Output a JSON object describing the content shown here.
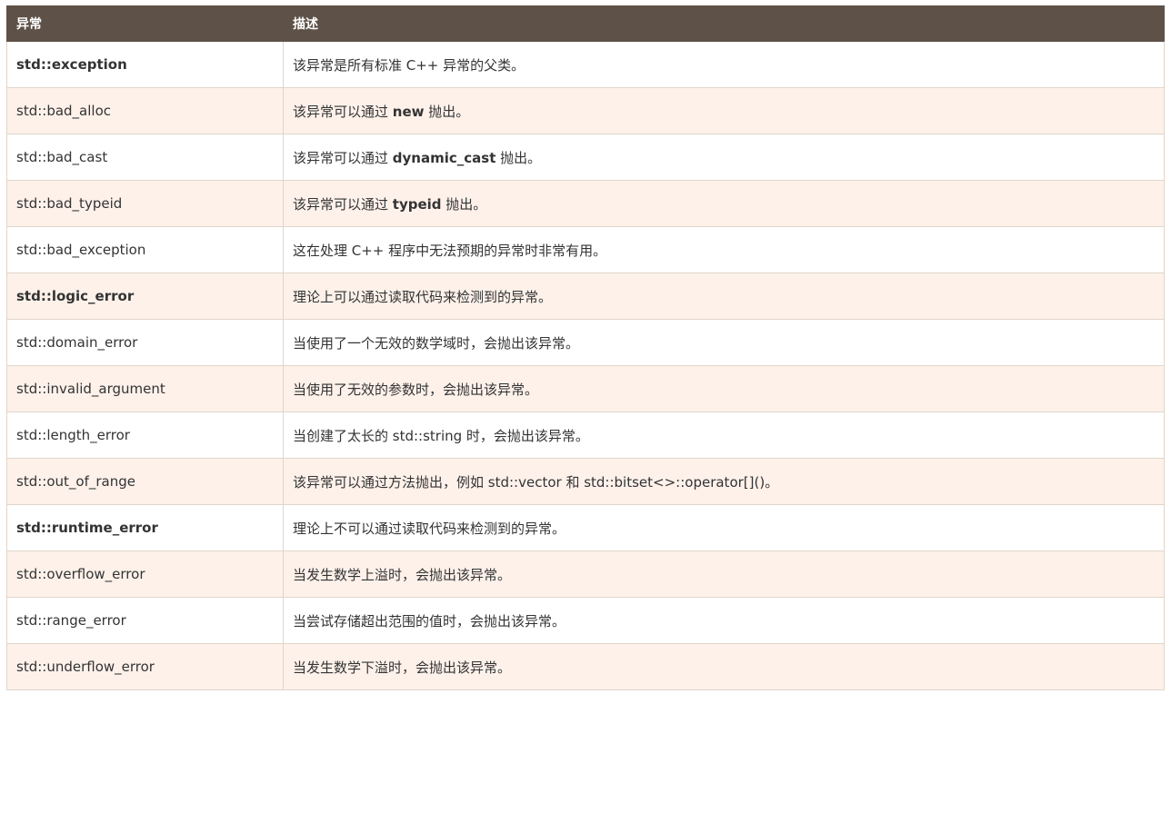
{
  "headers": [
    "异常",
    "描述"
  ],
  "rows": [
    {
      "name": "std::exception",
      "bold": true,
      "desc": [
        {
          "t": "该异常是所有标准 C++ 异常的父类。"
        }
      ]
    },
    {
      "name": "std::bad_alloc",
      "bold": false,
      "desc": [
        {
          "t": "该异常可以通过 "
        },
        {
          "t": "new",
          "b": true
        },
        {
          "t": " 抛出。"
        }
      ]
    },
    {
      "name": "std::bad_cast",
      "bold": false,
      "desc": [
        {
          "t": "该异常可以通过 "
        },
        {
          "t": "dynamic_cast",
          "b": true
        },
        {
          "t": " 抛出。"
        }
      ]
    },
    {
      "name": "std::bad_typeid",
      "bold": false,
      "desc": [
        {
          "t": "该异常可以通过 "
        },
        {
          "t": "typeid",
          "b": true
        },
        {
          "t": " 抛出。"
        }
      ]
    },
    {
      "name": "std::bad_exception",
      "bold": false,
      "desc": [
        {
          "t": "这在处理 C++ 程序中无法预期的异常时非常有用。"
        }
      ]
    },
    {
      "name": "std::logic_error",
      "bold": true,
      "desc": [
        {
          "t": "理论上可以通过读取代码来检测到的异常。"
        }
      ]
    },
    {
      "name": "std::domain_error",
      "bold": false,
      "desc": [
        {
          "t": "当使用了一个无效的数学域时，会抛出该异常。"
        }
      ]
    },
    {
      "name": "std::invalid_argument",
      "bold": false,
      "desc": [
        {
          "t": "当使用了无效的参数时，会抛出该异常。"
        }
      ]
    },
    {
      "name": "std::length_error",
      "bold": false,
      "desc": [
        {
          "t": "当创建了太长的 std::string 时，会抛出该异常。"
        }
      ]
    },
    {
      "name": "std::out_of_range",
      "bold": false,
      "desc": [
        {
          "t": "该异常可以通过方法抛出，例如 std::vector 和 std::bitset<>::operator[]()。"
        }
      ]
    },
    {
      "name": "std::runtime_error",
      "bold": true,
      "desc": [
        {
          "t": "理论上不可以通过读取代码来检测到的异常。"
        }
      ]
    },
    {
      "name": "std::overflow_error",
      "bold": false,
      "desc": [
        {
          "t": "当发生数学上溢时，会抛出该异常。"
        }
      ]
    },
    {
      "name": "std::range_error",
      "bold": false,
      "desc": [
        {
          "t": "当尝试存储超出范围的值时，会抛出该异常。"
        }
      ]
    },
    {
      "name": "std::underflow_error",
      "bold": false,
      "desc": [
        {
          "t": "当发生数学下溢时，会抛出该异常。"
        }
      ]
    }
  ],
  "colors": {
    "header_bg": "#5e5148",
    "row_alt_bg": "#fdf1ea",
    "border": "#e1d5ca",
    "text": "#333333"
  }
}
